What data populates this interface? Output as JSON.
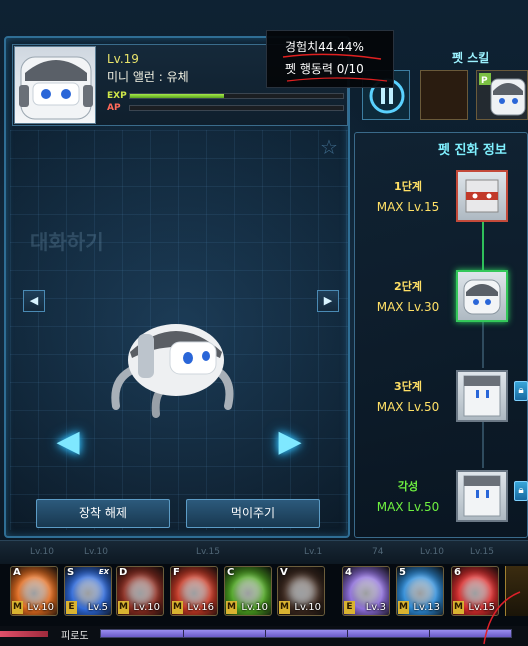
{
  "header": {
    "level": "Lv.19",
    "pet_name": "미니 앨런 : 유체",
    "exp_label": "EXP",
    "ap_label": "AP",
    "exp_fraction": 0.44,
    "ap_fraction": 0.0
  },
  "tooltip": {
    "exp_text": "경험치44.44%",
    "action_text": "펫 행동력 0/10"
  },
  "skills": {
    "title": "펫 스킬"
  },
  "evolution": {
    "title": "펫 진화 정보",
    "stages": [
      {
        "label": "1단계",
        "max": "MAX Lv.15",
        "state": "done"
      },
      {
        "label": "2단계",
        "max": "MAX Lv.30",
        "state": "current"
      },
      {
        "label": "3단계",
        "max": "MAX Lv.50",
        "state": "locked"
      },
      {
        "label": "각성",
        "max": "MAX Lv.50",
        "state": "locked"
      }
    ]
  },
  "background": {
    "ghost_text": "대화하기"
  },
  "actions": {
    "unequip_label": "장착 해제",
    "feed_label": "먹이주기"
  },
  "hotbar": {
    "ghost_levels": [
      "Lv.10",
      "Lv.10",
      "Lv.15",
      "Lv.1",
      "74",
      "Lv.10",
      "Lv.15"
    ],
    "slots": [
      {
        "key": "A",
        "tag": "M",
        "level": "Lv.10",
        "icon": "fire-burst-icon",
        "color": "#e0691c"
      },
      {
        "key": "S",
        "tag": "E",
        "level": "Lv.5",
        "icon": "blue-wave-icon",
        "color": "#2a66d8",
        "ex": "EX"
      },
      {
        "key": "D",
        "tag": "M",
        "level": "Lv.10",
        "icon": "dark-warrior-icon",
        "color": "#8a2a1e"
      },
      {
        "key": "F",
        "tag": "M",
        "level": "Lv.16",
        "icon": "red-slash-icon",
        "color": "#c43622"
      },
      {
        "key": "C",
        "tag": "M",
        "level": "Lv.10",
        "icon": "green-vortex-icon",
        "color": "#4aa21e"
      },
      {
        "key": "V",
        "tag": "M",
        "level": "Lv.10",
        "icon": "dark-flame-icon",
        "color": "#3a261c"
      },
      {
        "key": "4",
        "tag": "E",
        "level": "Lv.3",
        "icon": "purple-crystal-icon",
        "color": "#8a6ad8"
      },
      {
        "key": "5",
        "tag": "M",
        "level": "Lv.13",
        "icon": "ice-burst-icon",
        "color": "#2a8ad8"
      },
      {
        "key": "6",
        "tag": "M",
        "level": "Lv.15",
        "icon": "red-explosion-icon",
        "color": "#d82a2a"
      }
    ]
  },
  "fatigue": {
    "label": "피로도",
    "fraction": 1.0
  }
}
